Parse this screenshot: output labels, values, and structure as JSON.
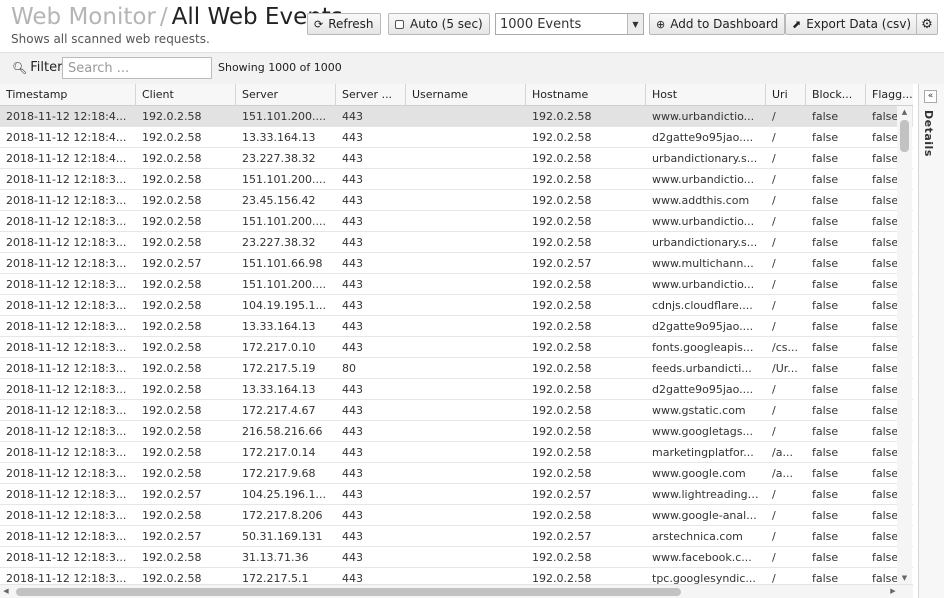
{
  "header": {
    "breadcrumb": "Web Monitor",
    "separator": "/",
    "page_title": "All Web Events",
    "subtitle": "Shows all scanned web requests.",
    "refresh_label": "Refresh",
    "auto_label": "Auto (5 sec)",
    "events_select_value": "1000 Events",
    "add_dashboard_label": "Add to Dashboard",
    "export_label": "Export Data (csv)"
  },
  "filterbar": {
    "filter_label": "Filter",
    "search_placeholder": "Search ...",
    "showing_text": "Showing 1000 of 1000"
  },
  "table": {
    "columns": [
      "Timestamp",
      "Client",
      "Server",
      "Server ...",
      "Username",
      "Hostname",
      "Host",
      "Uri",
      "Block...",
      "Flagg..."
    ],
    "rows": [
      [
        "2018-11-12 12:18:4...",
        "192.0.2.58",
        "151.101.200....",
        "443",
        "",
        "192.0.2.58",
        "www.urbandictio...",
        "/",
        "false",
        "false"
      ],
      [
        "2018-11-12 12:18:4...",
        "192.0.2.58",
        "13.33.164.13",
        "443",
        "",
        "192.0.2.58",
        "d2gatte9o95jao....",
        "/",
        "false",
        "false"
      ],
      [
        "2018-11-12 12:18:4...",
        "192.0.2.58",
        "23.227.38.32",
        "443",
        "",
        "192.0.2.58",
        "urbandictionary.s...",
        "/",
        "false",
        "false"
      ],
      [
        "2018-11-12 12:18:3...",
        "192.0.2.58",
        "151.101.200....",
        "443",
        "",
        "192.0.2.58",
        "www.urbandictio...",
        "/",
        "false",
        "false"
      ],
      [
        "2018-11-12 12:18:3...",
        "192.0.2.58",
        "23.45.156.42",
        "443",
        "",
        "192.0.2.58",
        "www.addthis.com",
        "/",
        "false",
        "false"
      ],
      [
        "2018-11-12 12:18:3...",
        "192.0.2.58",
        "151.101.200....",
        "443",
        "",
        "192.0.2.58",
        "www.urbandictio...",
        "/",
        "false",
        "false"
      ],
      [
        "2018-11-12 12:18:3...",
        "192.0.2.58",
        "23.227.38.32",
        "443",
        "",
        "192.0.2.58",
        "urbandictionary.s...",
        "/",
        "false",
        "false"
      ],
      [
        "2018-11-12 12:18:3...",
        "192.0.2.57",
        "151.101.66.98",
        "443",
        "",
        "192.0.2.57",
        "www.multichann...",
        "/",
        "false",
        "false"
      ],
      [
        "2018-11-12 12:18:3...",
        "192.0.2.58",
        "151.101.200....",
        "443",
        "",
        "192.0.2.58",
        "www.urbandictio...",
        "/",
        "false",
        "false"
      ],
      [
        "2018-11-12 12:18:3...",
        "192.0.2.58",
        "104.19.195.1...",
        "443",
        "",
        "192.0.2.58",
        "cdnjs.cloudflare....",
        "/",
        "false",
        "false"
      ],
      [
        "2018-11-12 12:18:3...",
        "192.0.2.58",
        "13.33.164.13",
        "443",
        "",
        "192.0.2.58",
        "d2gatte9o95jao....",
        "/",
        "false",
        "false"
      ],
      [
        "2018-11-12 12:18:3...",
        "192.0.2.58",
        "172.217.0.10",
        "443",
        "",
        "192.0.2.58",
        "fonts.googleapis...",
        "/cs...",
        "false",
        "false"
      ],
      [
        "2018-11-12 12:18:3...",
        "192.0.2.58",
        "172.217.5.19",
        "80",
        "",
        "192.0.2.58",
        "feeds.urbandicti...",
        "/Ur...",
        "false",
        "false"
      ],
      [
        "2018-11-12 12:18:3...",
        "192.0.2.58",
        "13.33.164.13",
        "443",
        "",
        "192.0.2.58",
        "d2gatte9o95jao....",
        "/",
        "false",
        "false"
      ],
      [
        "2018-11-12 12:18:3...",
        "192.0.2.58",
        "172.217.4.67",
        "443",
        "",
        "192.0.2.58",
        "www.gstatic.com",
        "/",
        "false",
        "false"
      ],
      [
        "2018-11-12 12:18:3...",
        "192.0.2.58",
        "216.58.216.66",
        "443",
        "",
        "192.0.2.58",
        "www.googletags...",
        "/",
        "false",
        "false"
      ],
      [
        "2018-11-12 12:18:3...",
        "192.0.2.58",
        "172.217.0.14",
        "443",
        "",
        "192.0.2.58",
        "marketingplatfor...",
        "/a...",
        "false",
        "false"
      ],
      [
        "2018-11-12 12:18:3...",
        "192.0.2.58",
        "172.217.9.68",
        "443",
        "",
        "192.0.2.58",
        "www.google.com",
        "/a...",
        "false",
        "false"
      ],
      [
        "2018-11-12 12:18:3...",
        "192.0.2.57",
        "104.25.196.1...",
        "443",
        "",
        "192.0.2.57",
        "www.lightreading....",
        "/",
        "false",
        "false"
      ],
      [
        "2018-11-12 12:18:3...",
        "192.0.2.58",
        "172.217.8.206",
        "443",
        "",
        "192.0.2.58",
        "www.google-anal...",
        "/",
        "false",
        "false"
      ],
      [
        "2018-11-12 12:18:3...",
        "192.0.2.57",
        "50.31.169.131",
        "443",
        "",
        "192.0.2.57",
        "arstechnica.com",
        "/",
        "false",
        "false"
      ],
      [
        "2018-11-12 12:18:3...",
        "192.0.2.58",
        "31.13.71.36",
        "443",
        "",
        "192.0.2.58",
        "www.facebook.c...",
        "/",
        "false",
        "false"
      ],
      [
        "2018-11-12 12:18:3...",
        "192.0.2.58",
        "172.217.5.1",
        "443",
        "",
        "192.0.2.58",
        "tpc.googlesyndic...",
        "/",
        "false",
        "false"
      ]
    ]
  },
  "details": {
    "label": "Details"
  },
  "icons": {
    "refresh": "refresh-icon",
    "auto": "checkbox-icon",
    "add": "plus-circle-icon",
    "export": "export-icon",
    "settings": "gear-icon",
    "filter": "search-icon",
    "collapse": "chevrons-left-icon"
  },
  "colors": {
    "selected_row": "#e2e2e2",
    "header_bg": "#f7f7f7",
    "filterbar_bg": "#f2f2f2"
  }
}
